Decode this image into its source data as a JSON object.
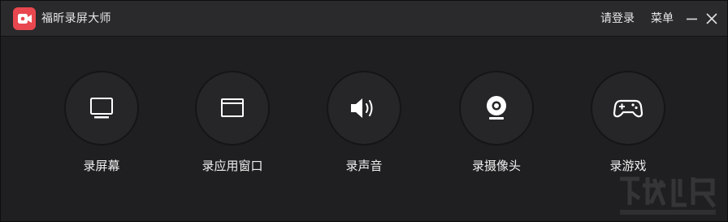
{
  "app": {
    "title": "福昕录屏大师",
    "login_label": "请登录",
    "menu_label": "菜单",
    "accent_color": "#e8474f"
  },
  "modes": [
    {
      "label": "录屏幕",
      "icon": "monitor-icon"
    },
    {
      "label": "录应用窗口",
      "icon": "window-icon"
    },
    {
      "label": "录声音",
      "icon": "speaker-icon"
    },
    {
      "label": "录摄像头",
      "icon": "webcam-icon"
    },
    {
      "label": "录游戏",
      "icon": "gamepad-icon"
    }
  ]
}
